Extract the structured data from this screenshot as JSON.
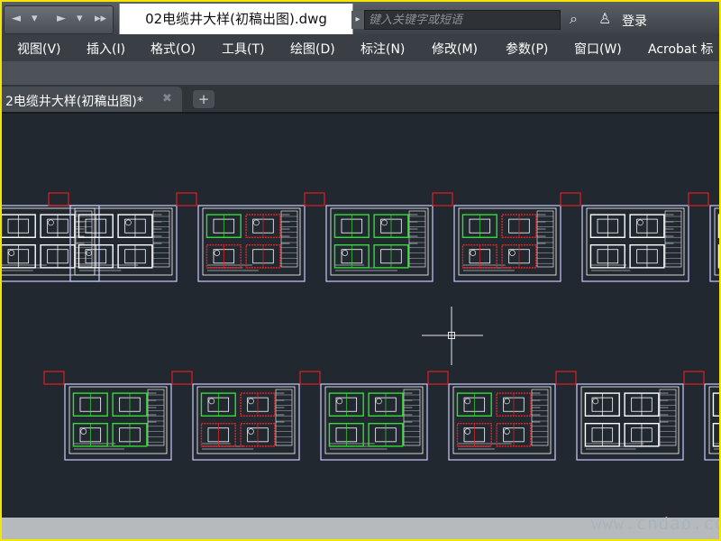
{
  "titlebar": {
    "quick_access": [
      "◄",
      "▾",
      "►",
      "▾",
      "▸▸"
    ],
    "document_title": "02电缆井大样(初稿出图).dwg",
    "search_placeholder": "键入关键字或短语",
    "login_label": "登录"
  },
  "menubar": {
    "items": [
      "视图(V)",
      "插入(I)",
      "格式(O)",
      "工具(T)",
      "绘图(D)",
      "标注(N)",
      "修改(M)",
      "参数(P)",
      "窗口(W)",
      "Acrobat 标"
    ]
  },
  "tabbar": {
    "active_tab": "2电缆井大样(初稿出图)*",
    "close_glyph": "✖",
    "add_glyph": "+"
  },
  "watermark": "www.cndao.com",
  "colors": {
    "canvas": "#212830",
    "sheet_border": "#c8ccff",
    "drawing_green": "#33dd33",
    "drawing_red": "#ee2222",
    "marker_red": "#dd1f1f"
  },
  "drawing_sheets": {
    "row1": [
      "sheet-1",
      "sheet-2",
      "sheet-3",
      "sheet-4",
      "sheet-5",
      "sheet-6",
      "sheet-7"
    ],
    "row2": [
      "sheet-8",
      "sheet-9",
      "sheet-10",
      "sheet-11",
      "sheet-12",
      "sheet-13"
    ]
  }
}
